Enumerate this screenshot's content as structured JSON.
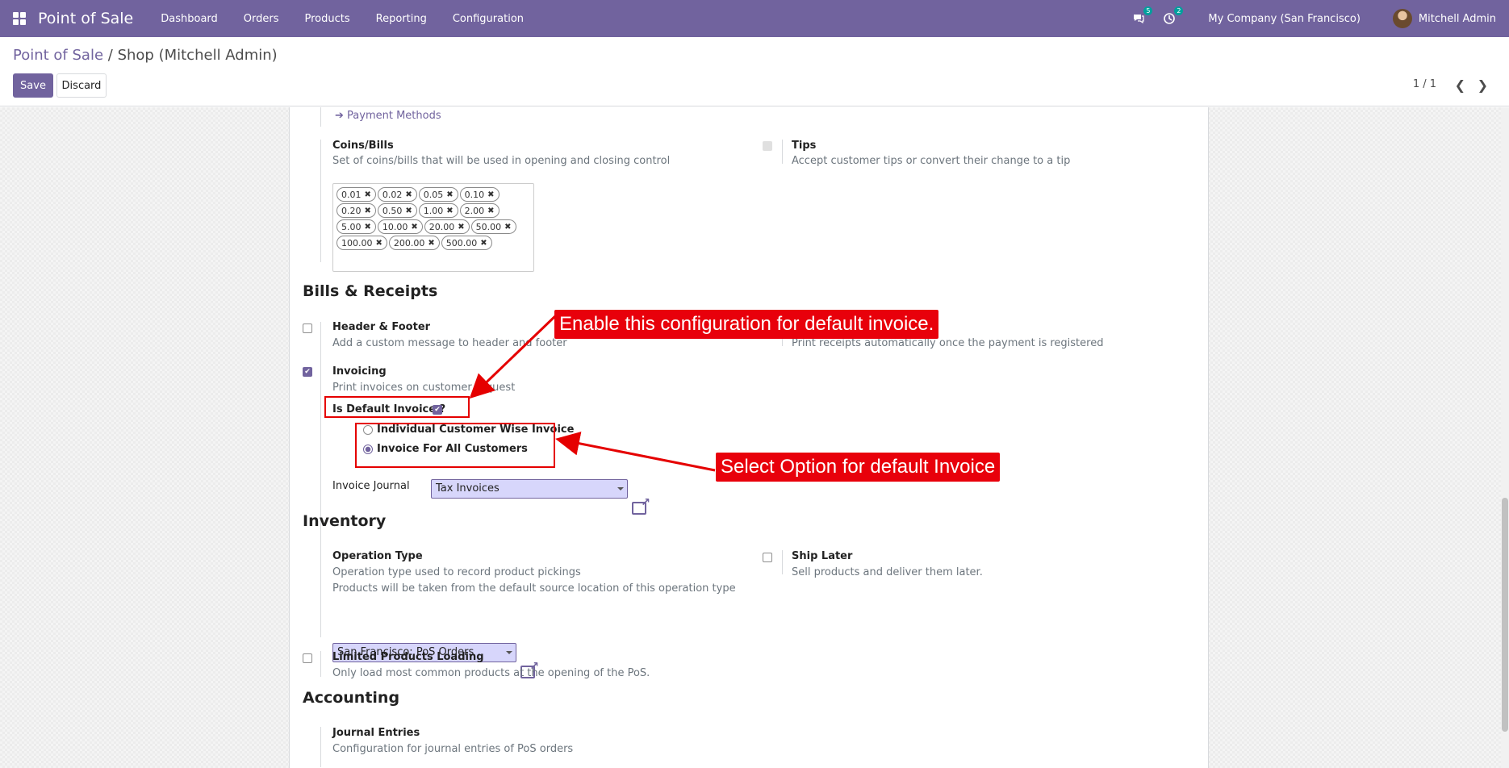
{
  "navbar": {
    "brand": "Point of Sale",
    "menu": [
      "Dashboard",
      "Orders",
      "Products",
      "Reporting",
      "Configuration"
    ],
    "messages_count": "5",
    "activities_count": "2",
    "company": "My Company (San Francisco)",
    "user": "Mitchell Admin"
  },
  "control": {
    "breadcrumb_parent": "Point of Sale",
    "breadcrumb_sep": "/",
    "breadcrumb_current": "Shop (Mitchell Admin)",
    "save_label": "Save",
    "discard_label": "Discard",
    "pager": "1 / 1"
  },
  "form": {
    "payment_methods_link": "Payment Methods",
    "coins": {
      "label": "Coins/Bills",
      "help": "Set of coins/bills that will be used in opening and closing control",
      "tags": [
        "0.01",
        "0.02",
        "0.05",
        "0.10",
        "0.20",
        "0.50",
        "1.00",
        "2.00",
        "5.00",
        "10.00",
        "20.00",
        "50.00",
        "100.00",
        "200.00",
        "500.00"
      ]
    },
    "tips": {
      "label": "Tips",
      "help": "Accept customer tips or convert their change to a tip",
      "checked": false
    },
    "bills_section": "Bills & Receipts",
    "header_footer": {
      "label": "Header & Footer",
      "help": "Add a custom message to header and footer",
      "checked": false
    },
    "auto_print_help": "Print receipts automatically once the payment is registered",
    "invoicing": {
      "label": "Invoicing",
      "help": "Print invoices on customer request",
      "checked": true
    },
    "default_invoice": {
      "label": "Is Default Invoice ?",
      "checked": true
    },
    "invoice_options": [
      {
        "label": "Individual Customer Wise Invoice",
        "selected": false
      },
      {
        "label": "Invoice For All Customers",
        "selected": true
      }
    ],
    "invoice_journal": {
      "label": "Invoice Journal",
      "value": "Tax Invoices"
    },
    "inventory_section": "Inventory",
    "operation_type": {
      "label": "Operation Type",
      "help1": "Operation type used to record product pickings",
      "help2": "Products will be taken from the default source location of this operation type",
      "value": "San Francisco: PoS Orders"
    },
    "ship_later": {
      "label": "Ship Later",
      "help": "Sell products and deliver them later.",
      "checked": false
    },
    "limited_products": {
      "label": "Limited Products Loading",
      "help": "Only load most common products at the opening of the PoS.",
      "checked": false
    },
    "accounting_section": "Accounting",
    "journal_entries": {
      "label": "Journal Entries",
      "help": "Configuration for journal entries of PoS orders"
    }
  },
  "annotations": {
    "callout_top": "Enable this configuration for default invoice.",
    "callout_right": "Select Option for default Invoice"
  },
  "colors": {
    "primary": "#71639e",
    "annotation": "#e8000b",
    "select_bg": "#d7d6fb"
  }
}
